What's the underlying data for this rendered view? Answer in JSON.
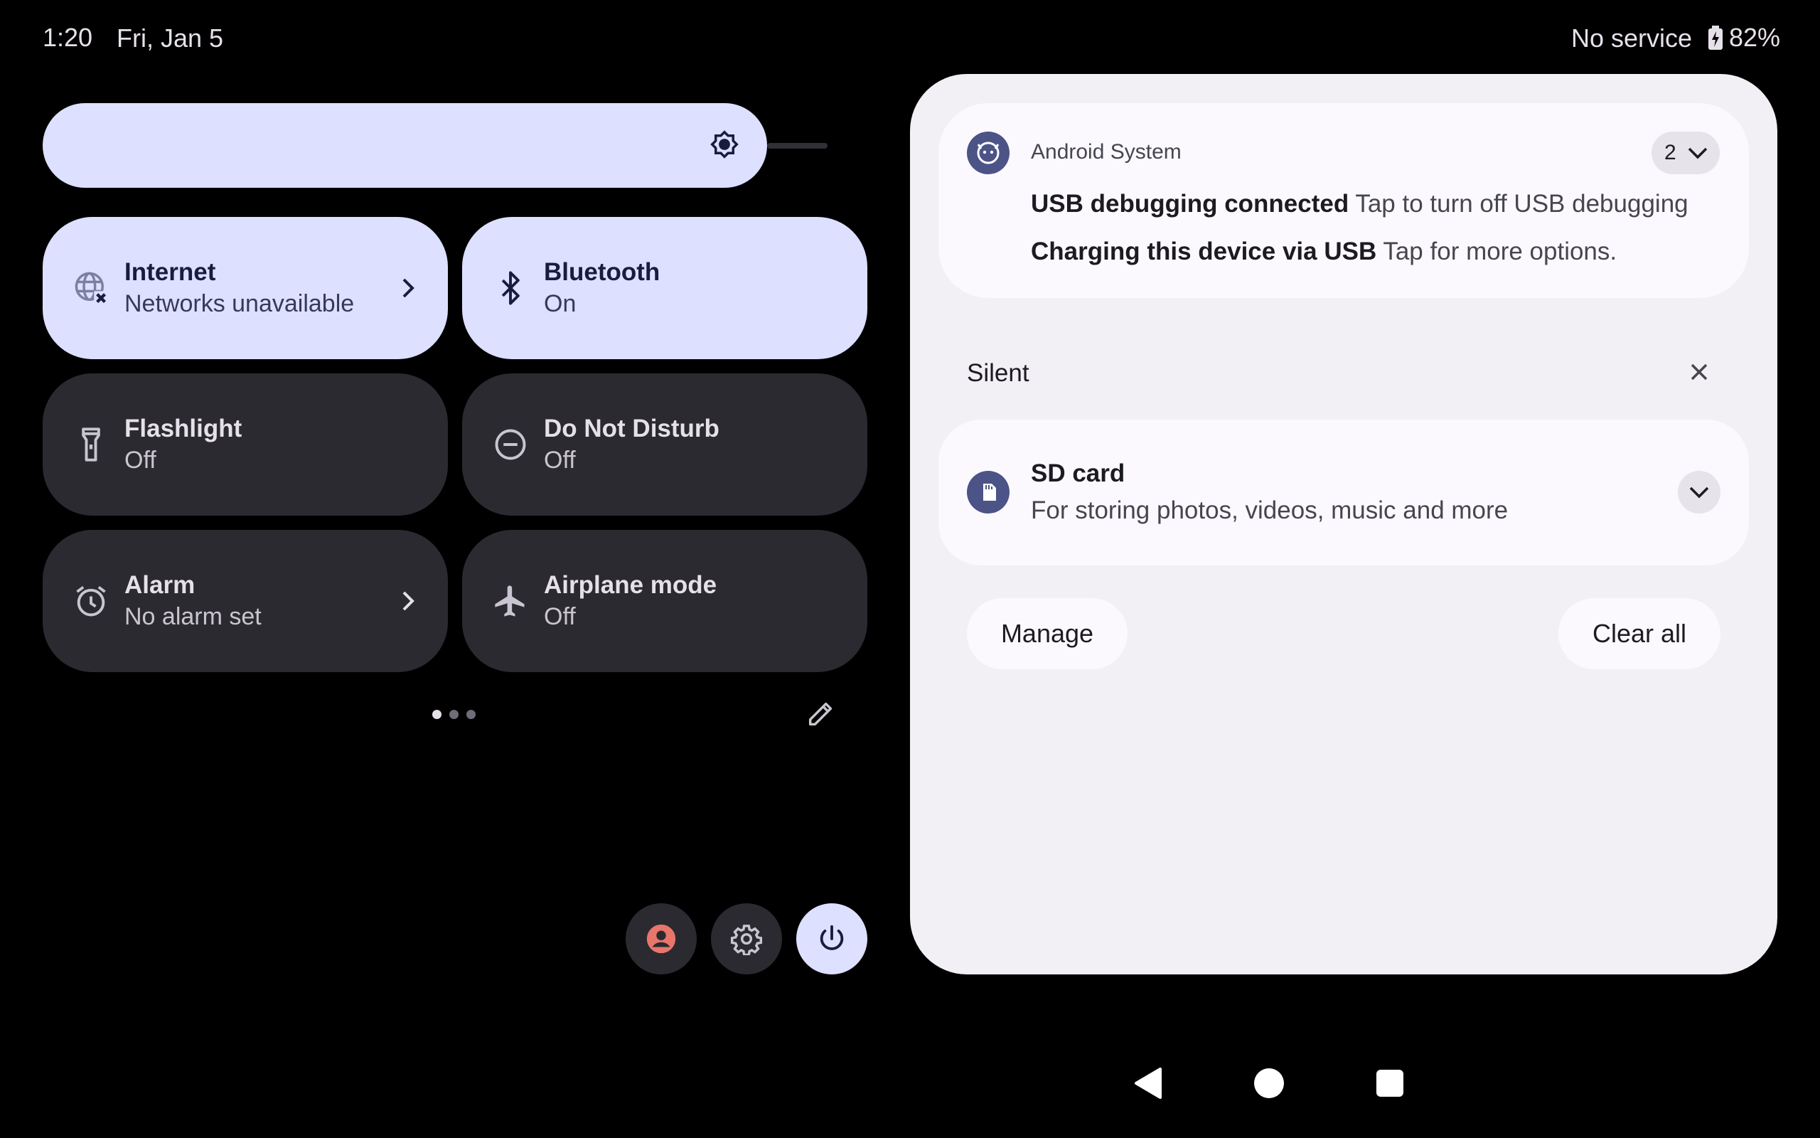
{
  "status_bar": {
    "time": "1:20",
    "date": "Fri, Jan 5",
    "network": "No service",
    "battery": "82%"
  },
  "brightness": {
    "icon": "brightness-icon",
    "level": 0.85
  },
  "tiles": [
    {
      "title": "Internet",
      "subtitle": "Networks unavailable",
      "icon": "globe-x-icon",
      "active": true
    },
    {
      "title": "Bluetooth",
      "subtitle": "On",
      "icon": "bluetooth-icon",
      "active": true
    },
    {
      "title": "Flashlight",
      "subtitle": "Off",
      "icon": "flashlight-icon",
      "active": false
    },
    {
      "title": "Do Not Disturb",
      "subtitle": "Off",
      "icon": "do-not-disturb-icon",
      "active": false
    },
    {
      "title": "Alarm",
      "subtitle": "No alarm set",
      "icon": "alarm-icon",
      "active": false
    },
    {
      "title": "Airplane mode",
      "subtitle": "Off",
      "icon": "airplane-icon",
      "active": false
    }
  ],
  "pager": {
    "pages": 3,
    "current": 1
  },
  "notifications": {
    "android_system": {
      "app": "Android System",
      "count": "2",
      "items": [
        {
          "title": "USB debugging connected",
          "text": "Tap to turn off USB debugging"
        },
        {
          "title": "Charging this device via USB",
          "text": "Tap for more options."
        }
      ]
    },
    "silent_header": "Silent",
    "sd_card": {
      "title": "SD card",
      "text": "For storing photos, videos, music and more"
    },
    "manage_label": "Manage",
    "clear_all_label": "Clear all"
  },
  "colors": {
    "accent": "#dde0ff",
    "tile_inactive": "#2b2a31",
    "panel": "#f2eff5",
    "app_icon": "#4c5386"
  }
}
